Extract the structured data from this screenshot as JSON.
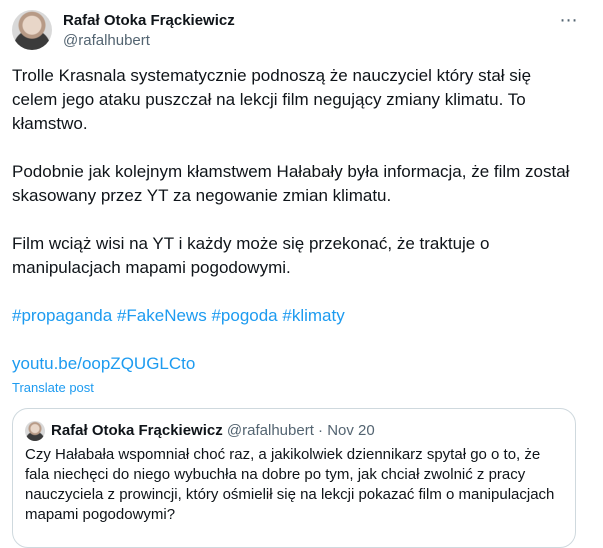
{
  "tweet": {
    "author_name": "Rafał Otoka Frąckiewicz",
    "author_handle": "@rafalhubert",
    "paragraphs": [
      "Trolle Krasnala systematycznie podnoszą że nauczyciel który stał się celem jego ataku puszczał na lekcji film negujący zmiany klimatu. To kłamstwo.",
      "Podobnie jak kolejnym kłamstwem Hałabały była informacja, że film został skasowany przez YT za negowanie zmian klimatu.",
      "Film wciąż wisi na YT i każdy może się przekonać, że traktuje o manipulacjach mapami pogodowymi."
    ],
    "hashtags": [
      "#propaganda",
      "#FakeNews",
      "#pogoda",
      "#klimaty"
    ],
    "link": "youtu.be/oopZQUGLCto",
    "translate_label": "Translate post",
    "more_icon": "⋯"
  },
  "quote": {
    "author_name": "Rafał Otoka Frąckiewicz",
    "author_handle": "@rafalhubert",
    "separator": "·",
    "date": "Nov 20",
    "text": "Czy Hałabała wspomniał choć raz, a jakikolwiek dziennikarz spytał go o to, że fala niechęci do niego wybuchła na dobre po tym, jak chciał zwolnić z pracy nauczyciela z prowincji, który ośmielił się na lekcji pokazać film o manipulacjach mapami pogodowymi?"
  },
  "colors": {
    "link": "#1d9bf0",
    "text": "#0f1419",
    "muted": "#536471",
    "border": "#cfd9de"
  }
}
